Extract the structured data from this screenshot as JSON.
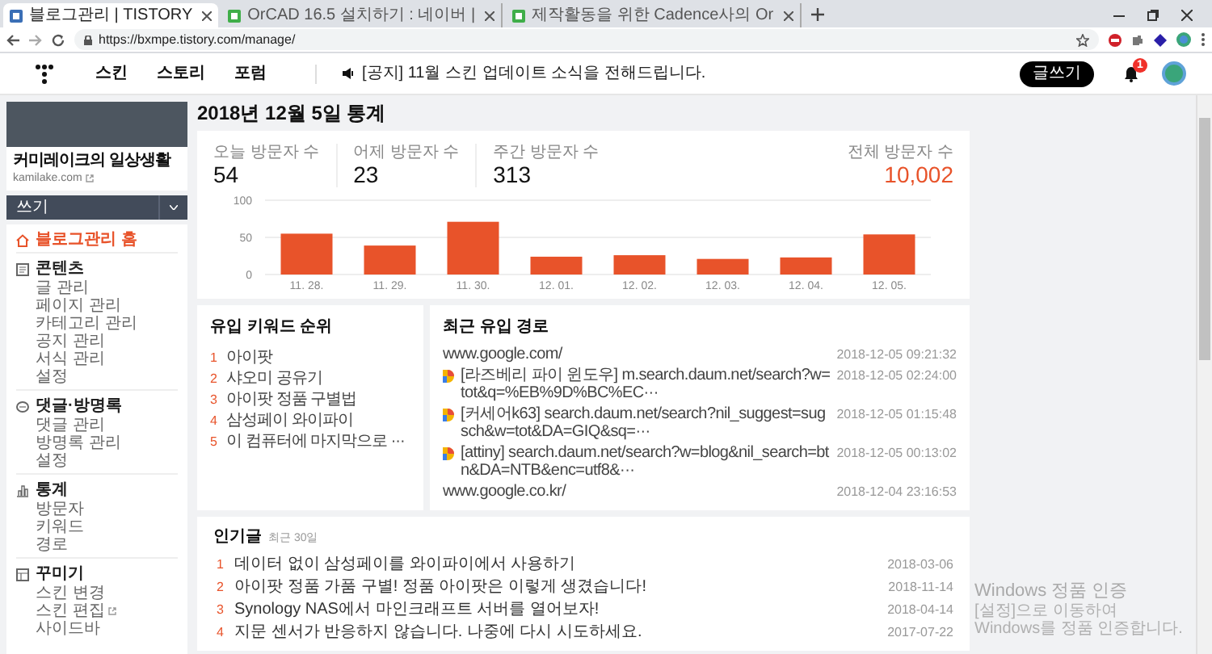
{
  "browser": {
    "tabs": [
      {
        "title": "블로그관리 | TISTORY",
        "selected": true
      },
      {
        "title": "OrCAD 16.5 설치하기 : 네이버 |",
        "selected": false
      },
      {
        "title": "제작활동을 위한 Cadence사의 Or",
        "selected": false
      }
    ],
    "address": "https://bxmpe.tistory.com/manage/"
  },
  "header": {
    "nav": [
      "스킨",
      "스토리",
      "포럼"
    ],
    "notice": "[공지] 11월 스킨 업데이트 소식을 전해드립니다.",
    "write_button": "글쓰기",
    "notification_count": "1"
  },
  "sidebar": {
    "blog_name": "커미레이크의 일상생활",
    "blog_url": "kamilake.com",
    "write": "쓰기",
    "home": "블로그관리 홈",
    "groups": [
      {
        "kind": "content",
        "title": "콘텐츠",
        "items": [
          {
            "label": "글 관리",
            "external": false
          },
          {
            "label": "페이지 관리",
            "external": false
          },
          {
            "label": "카테고리 관리",
            "external": false
          },
          {
            "label": "공지 관리",
            "external": false
          },
          {
            "label": "서식 관리",
            "external": false
          },
          {
            "label": "설정",
            "external": false
          }
        ]
      },
      {
        "kind": "comments",
        "title": "댓글·방명록",
        "items": [
          {
            "label": "댓글 관리",
            "external": false
          },
          {
            "label": "방명록 관리",
            "external": false
          },
          {
            "label": "설정",
            "external": false
          }
        ]
      },
      {
        "kind": "stats",
        "title": "통계",
        "items": [
          {
            "label": "방문자",
            "external": false
          },
          {
            "label": "키워드",
            "external": false
          },
          {
            "label": "경로",
            "external": false
          }
        ]
      },
      {
        "kind": "design",
        "title": "꾸미기",
        "items": [
          {
            "label": "스킨 변경",
            "external": false
          },
          {
            "label": "스킨 편집",
            "external": true
          },
          {
            "label": "사이드바",
            "external": false
          }
        ]
      }
    ]
  },
  "page_title": "2018년 12월 5일 통계",
  "stats": {
    "items": [
      {
        "label": "오늘 방문자 수",
        "value": "54",
        "highlight": false
      },
      {
        "label": "어제 방문자 수",
        "value": "23",
        "highlight": false
      },
      {
        "label": "주간 방문자 수",
        "value": "313",
        "highlight": false
      },
      {
        "label": "전체 방문자 수",
        "value": "10,002",
        "highlight": true
      }
    ],
    "chart_data": {
      "type": "bar",
      "categories": [
        "11. 28.",
        "11. 29.",
        "11. 30.",
        "12. 01.",
        "12. 02.",
        "12. 03.",
        "12. 04.",
        "12. 05."
      ],
      "series": [
        {
          "color": "#e8532a",
          "values": [
            55,
            39,
            71,
            24,
            26,
            21,
            23,
            54
          ]
        }
      ],
      "ylim": [
        0,
        100
      ],
      "yticks": [
        0,
        50,
        100
      ]
    }
  },
  "keywords": {
    "title": "유입 키워드 순위",
    "items": [
      {
        "rank": "1",
        "text": "아이팟"
      },
      {
        "rank": "2",
        "text": "샤오미 공유기"
      },
      {
        "rank": "3",
        "text": "아이팟 정품 구별법"
      },
      {
        "rank": "4",
        "text": "삼성페이 와이파이"
      },
      {
        "rank": "5",
        "text": "이 컴퓨터에 마지막으로 ···"
      }
    ]
  },
  "referrers": {
    "title": "최근 유입 경로",
    "items": [
      {
        "kind": "plain",
        "text": "www.google.com/",
        "time": "2018-12-05 09:21:32"
      },
      {
        "kind": "daum",
        "text": "[라즈베리 파이 윈도우] m.search.daum.net/search?w=tot&q=%EB%9D%BC%EC···",
        "time": "2018-12-05 02:24:00"
      },
      {
        "kind": "daum",
        "text": "[커세어k63] search.daum.net/search?nil_suggest=sugsch&w=tot&DA=GIQ&sq=···",
        "time": "2018-12-05 01:15:48"
      },
      {
        "kind": "daum",
        "text": "[attiny] search.daum.net/search?w=blog&nil_search=btn&DA=NTB&enc=utf8&···",
        "time": "2018-12-05 00:13:02"
      },
      {
        "kind": "plain",
        "text": "www.google.co.kr/",
        "time": "2018-12-04 23:16:53"
      }
    ]
  },
  "popular": {
    "title": "인기글",
    "subtitle": "최근 30일",
    "items": [
      {
        "rank": "1",
        "title": "데이터 없이 삼성페이를 와이파이에서 사용하기",
        "date": "2018-03-06"
      },
      {
        "rank": "2",
        "title": "아이팟 정품 가품 구별! 정품 아이팟은 이렇게 생겼습니다!",
        "date": "2018-11-14"
      },
      {
        "rank": "3",
        "title": "Synology NAS에서 마인크래프트 서버를 열어보자!",
        "date": "2018-04-14"
      },
      {
        "rank": "4",
        "title": "지문 센서가 반응하지 않습니다. 나중에 다시 시도하세요.",
        "date": "2017-07-22"
      }
    ]
  },
  "activation_notice": {
    "title": "Windows 정품 인증",
    "text": "[설정]으로 이동하여 Windows를 정품 인증합니다."
  }
}
